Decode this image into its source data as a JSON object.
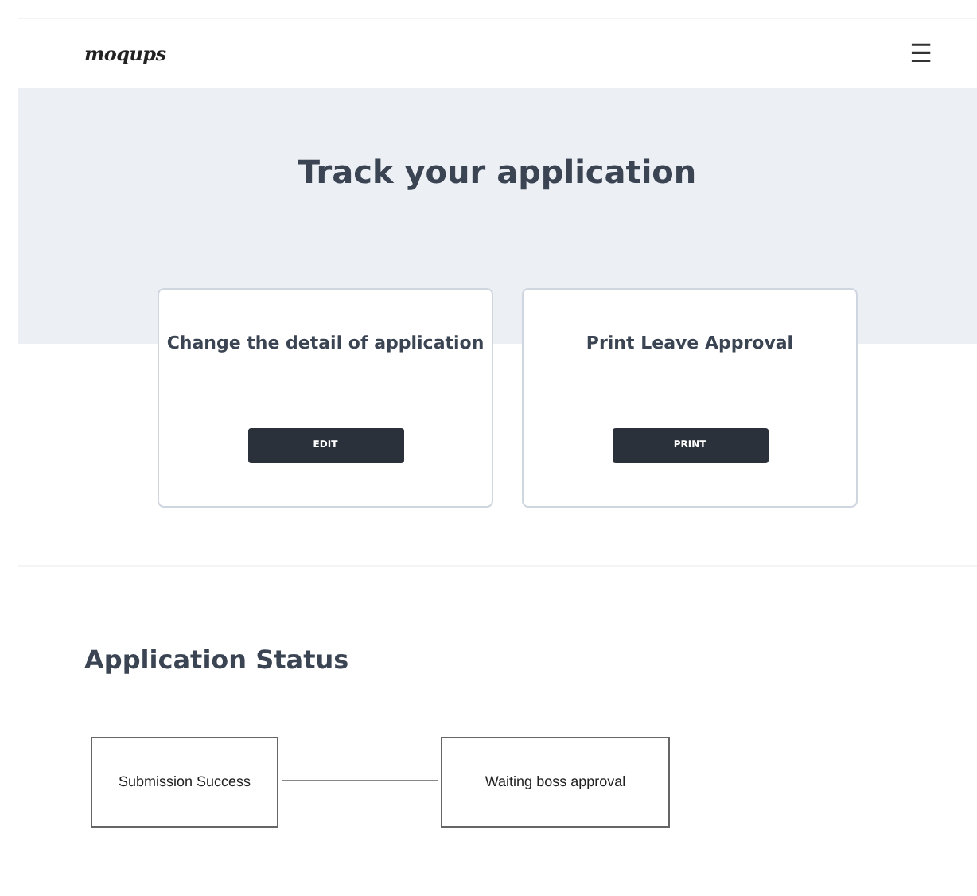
{
  "header": {
    "logo": "moqups",
    "menu_icon": "☰"
  },
  "hero": {
    "title": "Track your application"
  },
  "cards": [
    {
      "title": "Change the detail of application",
      "button": "EDIT"
    },
    {
      "title": "Print Leave Approval",
      "button": "PRINT"
    }
  ],
  "status": {
    "title": "Application Status",
    "steps": [
      {
        "label": "Submission Success"
      },
      {
        "label": "Waiting boss approval"
      }
    ]
  }
}
